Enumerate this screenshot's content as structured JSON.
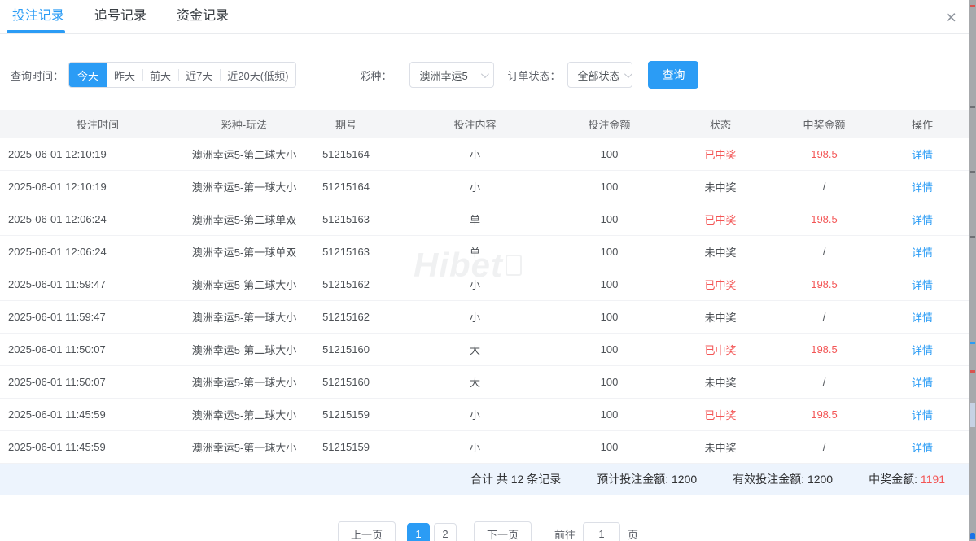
{
  "tabs": [
    {
      "label": "投注记录",
      "active": true
    },
    {
      "label": "追号记录",
      "active": false
    },
    {
      "label": "资金记录",
      "active": false
    }
  ],
  "close_icon": "×",
  "filters": {
    "time_label": "查询时间：",
    "time_options": [
      {
        "label": "今天",
        "active": true
      },
      {
        "label": "昨天",
        "active": false
      },
      {
        "label": "前天",
        "active": false
      },
      {
        "label": "近7天",
        "active": false
      },
      {
        "label": "近20天(低频)",
        "active": false
      }
    ],
    "lottery_label": "彩种：",
    "lottery_value": "澳洲幸运5",
    "status_label": "订单状态：",
    "status_value": "全部状态",
    "query_button": "查询"
  },
  "table": {
    "headers": [
      "投注时间",
      "彩种-玩法",
      "期号",
      "投注内容",
      "投注金额",
      "状态",
      "中奖金额",
      "操作"
    ],
    "action": "详情",
    "rows": [
      {
        "time": "2025-06-01 12:10:19",
        "game": "澳洲幸运5-第二球大小",
        "issue": "51215164",
        "content": "小",
        "amount": "100",
        "status": "已中奖",
        "win": "198.5",
        "won": true
      },
      {
        "time": "2025-06-01 12:10:19",
        "game": "澳洲幸运5-第一球大小",
        "issue": "51215164",
        "content": "小",
        "amount": "100",
        "status": "未中奖",
        "win": "/",
        "won": false
      },
      {
        "time": "2025-06-01 12:06:24",
        "game": "澳洲幸运5-第二球单双",
        "issue": "51215163",
        "content": "单",
        "amount": "100",
        "status": "已中奖",
        "win": "198.5",
        "won": true
      },
      {
        "time": "2025-06-01 12:06:24",
        "game": "澳洲幸运5-第一球单双",
        "issue": "51215163",
        "content": "单",
        "amount": "100",
        "status": "未中奖",
        "win": "/",
        "won": false
      },
      {
        "time": "2025-06-01 11:59:47",
        "game": "澳洲幸运5-第二球大小",
        "issue": "51215162",
        "content": "小",
        "amount": "100",
        "status": "已中奖",
        "win": "198.5",
        "won": true
      },
      {
        "time": "2025-06-01 11:59:47",
        "game": "澳洲幸运5-第一球大小",
        "issue": "51215162",
        "content": "小",
        "amount": "100",
        "status": "未中奖",
        "win": "/",
        "won": false
      },
      {
        "time": "2025-06-01 11:50:07",
        "game": "澳洲幸运5-第二球大小",
        "issue": "51215160",
        "content": "大",
        "amount": "100",
        "status": "已中奖",
        "win": "198.5",
        "won": true
      },
      {
        "time": "2025-06-01 11:50:07",
        "game": "澳洲幸运5-第一球大小",
        "issue": "51215160",
        "content": "大",
        "amount": "100",
        "status": "未中奖",
        "win": "/",
        "won": false
      },
      {
        "time": "2025-06-01 11:45:59",
        "game": "澳洲幸运5-第二球大小",
        "issue": "51215159",
        "content": "小",
        "amount": "100",
        "status": "已中奖",
        "win": "198.5",
        "won": true
      },
      {
        "time": "2025-06-01 11:45:59",
        "game": "澳洲幸运5-第一球大小",
        "issue": "51215159",
        "content": "小",
        "amount": "100",
        "status": "未中奖",
        "win": "/",
        "won": false
      }
    ]
  },
  "summary": {
    "total": "合计 共 12 条记录",
    "expected": "预计投注金额: 1200",
    "valid": "有效投注金额: 1200",
    "win_label": "中奖金额: ",
    "win_value": "1191"
  },
  "pagination": {
    "prev": "上一页",
    "pages": [
      {
        "label": "1",
        "active": true
      },
      {
        "label": "2",
        "active": false
      }
    ],
    "next": "下一页",
    "goto_label": "前往",
    "goto_value": "1",
    "goto_suffix": "页"
  },
  "watermark": "Hibet",
  "colors": {
    "accent": "#2b9cf5",
    "win_red": "#f35555",
    "summary_bg": "#edf4fd",
    "header_bg": "#f4f5f7"
  }
}
